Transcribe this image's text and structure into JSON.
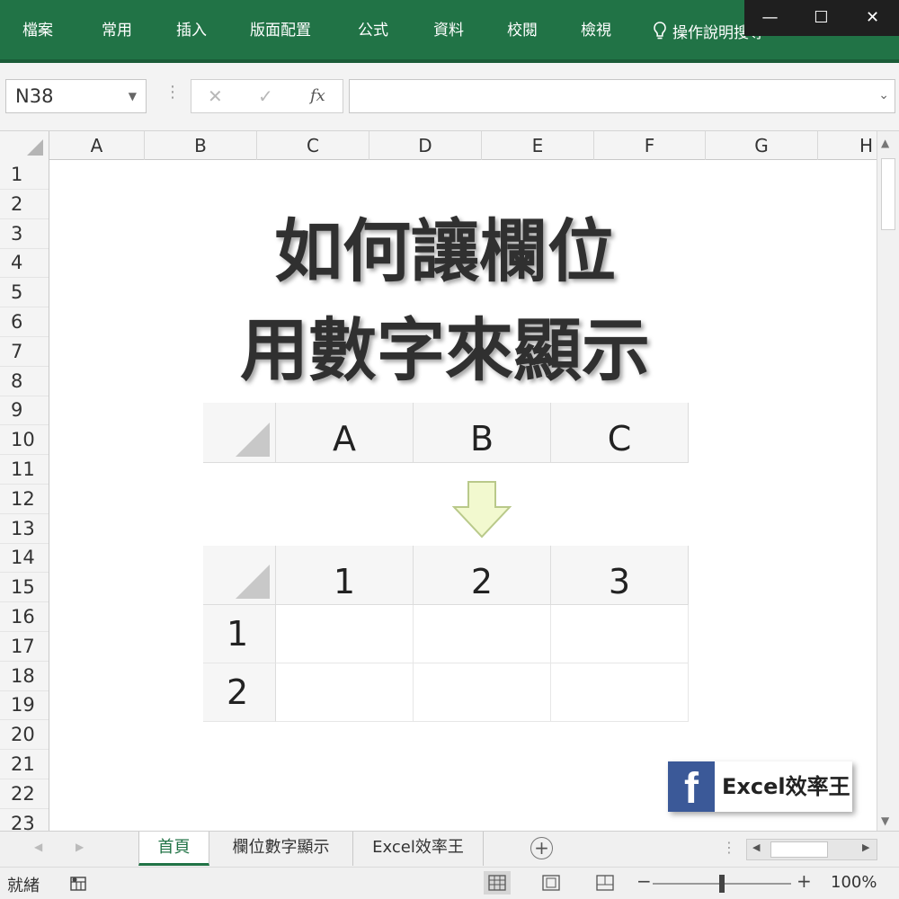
{
  "ribbon": {
    "tabs": [
      "檔案",
      "常用",
      "插入",
      "版面配置",
      "公式",
      "資料",
      "校閱",
      "檢視"
    ],
    "tell_me": "操作說明搜尋",
    "tell_icon": "lightbulb-icon",
    "accent": "#217346"
  },
  "window_controls": {
    "minimize": "—",
    "maximize": "☐",
    "close": "✕"
  },
  "formula_bar": {
    "name_box": "N38",
    "cancel_symbol": "✕",
    "enter_symbol": "✓",
    "fx_label": "fx",
    "formula_value": ""
  },
  "grid": {
    "columns": [
      "A",
      "B",
      "C",
      "D",
      "E",
      "F",
      "G",
      "H"
    ],
    "rows": [
      "1",
      "2",
      "3",
      "4",
      "5",
      "6",
      "7",
      "8",
      "9",
      "10",
      "11",
      "12",
      "13",
      "14",
      "15",
      "16",
      "17",
      "18",
      "19",
      "20",
      "21",
      "22",
      "23"
    ]
  },
  "content": {
    "title_line1": "如何讓欄位",
    "title_line2": "用數字來顯示",
    "before_headers": [
      "A",
      "B",
      "C"
    ],
    "after_headers": [
      "1",
      "2",
      "3"
    ],
    "after_rows": [
      "1",
      "2"
    ],
    "arrow_color": "#f0f8c8"
  },
  "badge": {
    "icon_letter": "f",
    "text": "Excel效率王",
    "brand_color": "#3b5998"
  },
  "sheets": {
    "tabs": [
      "首頁",
      "欄位數字顯示",
      "Excel效率王"
    ],
    "active_index": 0,
    "add_symbol": "+"
  },
  "status_bar": {
    "ready_text": "就緒",
    "zoom_minus": "−",
    "zoom_plus": "+",
    "zoom_percent": "100%",
    "zoom_level": 0.5
  }
}
